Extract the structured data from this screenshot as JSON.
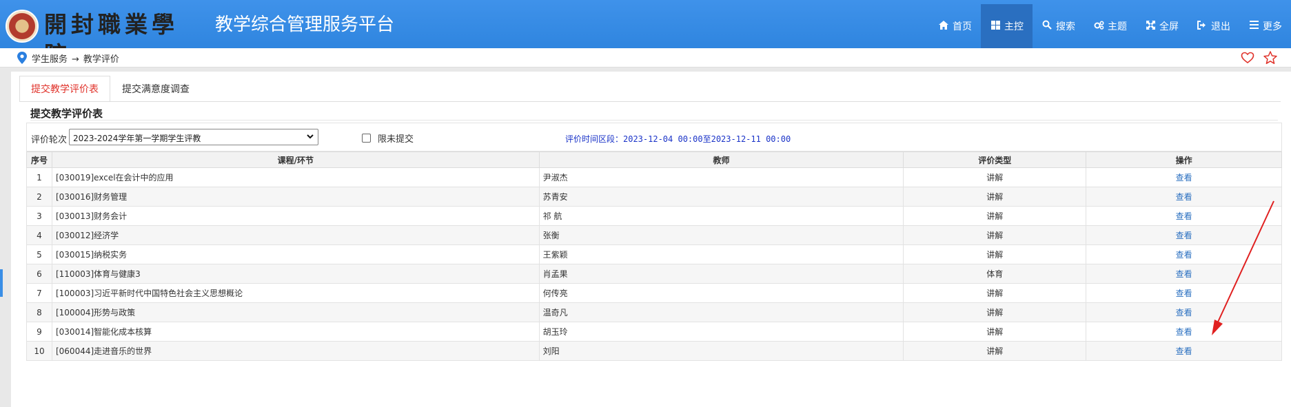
{
  "header": {
    "school_name": "開封職業學院",
    "platform_title": "教学综合管理服务平台",
    "nav": [
      {
        "icon": "home-icon",
        "label": "首页",
        "active": false
      },
      {
        "icon": "windows-icon",
        "label": "主控",
        "active": true
      },
      {
        "icon": "search-icon",
        "label": "搜索",
        "active": false
      },
      {
        "icon": "gears-icon",
        "label": "主题",
        "active": false
      },
      {
        "icon": "fullscreen-icon",
        "label": "全屏",
        "active": false
      },
      {
        "icon": "logout-icon",
        "label": "退出",
        "active": false
      },
      {
        "icon": "menu-icon",
        "label": "更多",
        "active": false
      }
    ]
  },
  "breadcrumb": {
    "parent": "学生服务",
    "separator": "→",
    "current": "教学评价"
  },
  "tabs": [
    {
      "label": "提交教学评价表",
      "active": true
    },
    {
      "label": "提交满意度调查",
      "active": false
    }
  ],
  "section_title": "提交教学评价表",
  "filter": {
    "round_label": "评价轮次",
    "round_value": "2023-2024学年第一学期学生评教",
    "only_unsubmitted_label": "限未提交",
    "only_unsubmitted_checked": false,
    "period_text": "评价时间区段：2023-12-04 00:00至2023-12-11 00:00"
  },
  "table": {
    "headers": [
      "序号",
      "课程/环节",
      "教师",
      "评价类型",
      "操作"
    ],
    "rows": [
      {
        "idx": "1",
        "course": "[030019]excel在会计中的应用",
        "teacher": "尹淑杰",
        "type": "讲解",
        "action": "查看"
      },
      {
        "idx": "2",
        "course": "[030016]财务管理",
        "teacher": "苏青安",
        "type": "讲解",
        "action": "查看"
      },
      {
        "idx": "3",
        "course": "[030013]财务会计",
        "teacher": "祁 航",
        "type": "讲解",
        "action": "查看"
      },
      {
        "idx": "4",
        "course": "[030012]经济学",
        "teacher": "张衡",
        "type": "讲解",
        "action": "查看"
      },
      {
        "idx": "5",
        "course": "[030015]纳税实务",
        "teacher": "王紫颖",
        "type": "讲解",
        "action": "查看"
      },
      {
        "idx": "6",
        "course": "[110003]体育与健康3",
        "teacher": "肖孟果",
        "type": "体育",
        "action": "查看"
      },
      {
        "idx": "7",
        "course": "[100003]习近平新时代中国特色社会主义思想概论",
        "teacher": "何传亮",
        "type": "讲解",
        "action": "查看"
      },
      {
        "idx": "8",
        "course": "[100004]形势与政策",
        "teacher": "温奇凡",
        "type": "讲解",
        "action": "查看"
      },
      {
        "idx": "9",
        "course": "[030014]智能化成本核算",
        "teacher": "胡玉玲",
        "type": "讲解",
        "action": "查看"
      },
      {
        "idx": "10",
        "course": "[060044]走进音乐的世界",
        "teacher": "刘阳",
        "type": "讲解",
        "action": "查看"
      }
    ]
  },
  "colors": {
    "header_blue": "#3a8ee6",
    "active_tab_red": "#e0322a",
    "link_blue": "#2a6fc0",
    "annotation_arrow": "#e02020"
  }
}
